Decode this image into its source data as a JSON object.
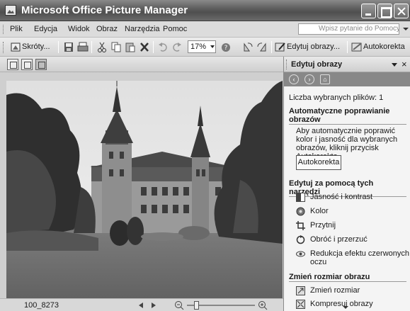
{
  "window": {
    "title": "Microsoft Office Picture Manager"
  },
  "menu": {
    "items": [
      "Plik",
      "Edycja",
      "Widok",
      "Obraz",
      "Narzędzia",
      "Pomoc"
    ],
    "help_placeholder": "Wpisz pytanie do Pomocy"
  },
  "toolbar": {
    "shortcuts_label": "Skróty...",
    "zoom_value": "17%",
    "edit_images_label": "Edytuj obrazy...",
    "autocorrect_label": "Autokorekta"
  },
  "status": {
    "file_name": "100_8273"
  },
  "task_pane": {
    "title": "Edytuj obrazy",
    "selected_count_text": "Liczba wybranych plików: 1",
    "section_auto": "Automatyczne poprawianie obrazów",
    "auto_description": "Aby automatycznie poprawić kolor i jasność dla wybranych obrazów, kliknij przycisk Autokorekta.",
    "autocorrect_button": "Autokorekta",
    "section_tools": "Edytuj za pomocą tych narzędzi",
    "tools": [
      "Jasność i kontrast",
      "Kolor",
      "Przytnij",
      "Obróć i przerzuć",
      "Redukcja efektu czerwonych oczu"
    ],
    "section_resize": "Zmień rozmiar obrazu",
    "resize_tools": [
      "Zmień rozmiar",
      "Kompresuj obrazy"
    ]
  },
  "icons": [
    "app-icon",
    "minimize-icon",
    "maximize-icon",
    "close-icon",
    "shortcut-icon",
    "save-icon",
    "cut-icon",
    "copy-icon",
    "paste-icon",
    "delete-icon",
    "undo-icon",
    "redo-icon",
    "help-icon",
    "rotate-left-icon",
    "rotate-right-icon",
    "edit-icon",
    "autocorrect-icon",
    "thumbnail-view-icon",
    "filmstrip-view-icon",
    "single-view-icon",
    "back-icon",
    "forward-icon",
    "home-icon",
    "zoom-out-icon",
    "zoom-in-icon"
  ]
}
